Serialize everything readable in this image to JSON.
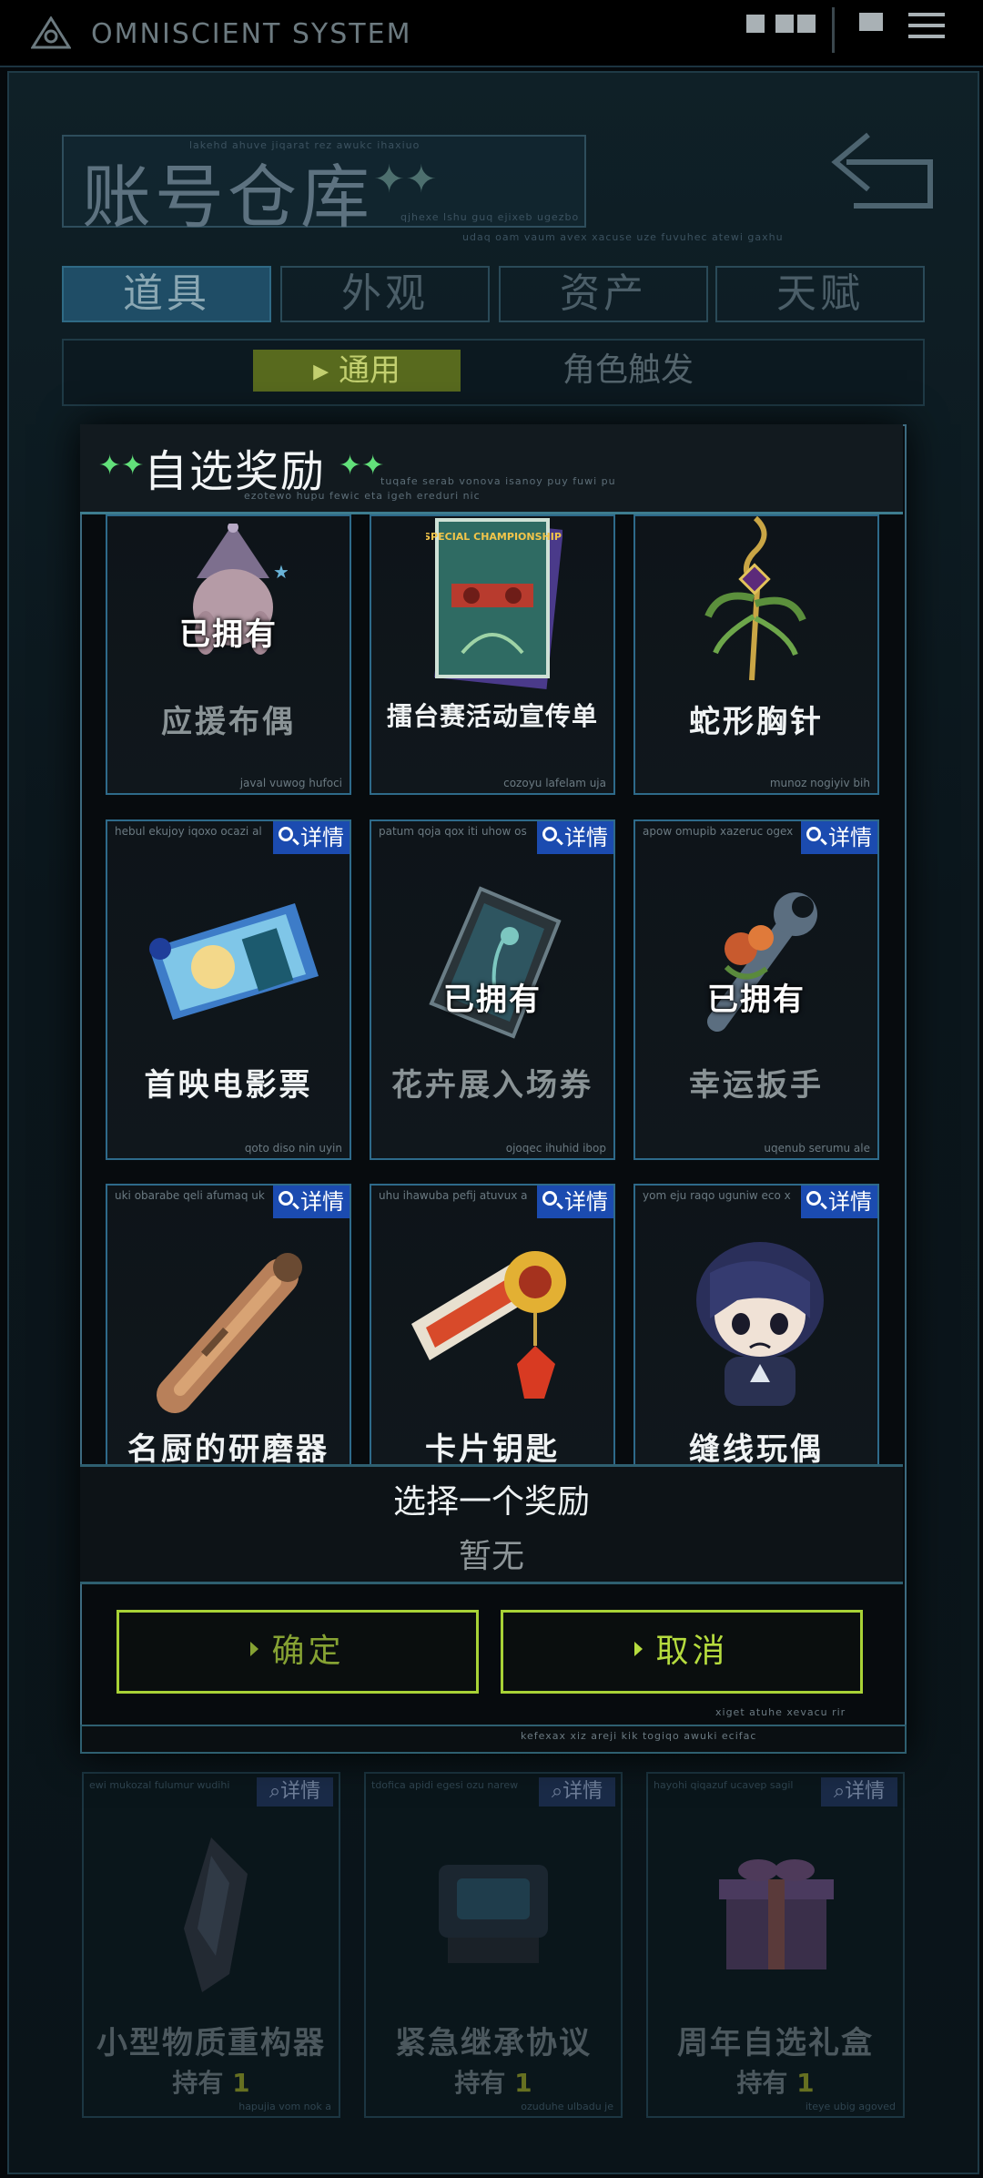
{
  "status_bar": {
    "app_name": "OMNISCIENT SYSTEM"
  },
  "warehouse": {
    "title": "账号仓库",
    "deco": "✦✦",
    "code_top": "lakehd ahuve jiqarat rez awukc ihaxiuo",
    "code_bottom": "qjhexe lshu guq ejixeb ugezbo",
    "code_line": "udaq oam vaum avex xacuse uze fuvuhec atewi gaxhu",
    "tabs": [
      "道具",
      "外观",
      "资产",
      "天赋"
    ],
    "active_tab": 0,
    "subtabs": [
      "通用",
      "角色触发"
    ],
    "active_subtab": 0
  },
  "bg_items": [
    {
      "name": "小型物质重构器",
      "count_label": "持有",
      "count": "1",
      "detail_label": "详情",
      "code": "ewi mukozal fulumur wudihi",
      "code2": "hapujia vom nok a"
    },
    {
      "name": "紧急继承协议",
      "count_label": "持有",
      "count": "1",
      "detail_label": "详情",
      "code": "tdofica apidi egesi ozu narew",
      "code2": "ozuduhe ulbadu je"
    },
    {
      "name": "周年自选礼盒",
      "count_label": "持有",
      "count": "1",
      "detail_label": "详情",
      "code": "hayohi qiqazuf ucavep sagil",
      "code2": "iteye ubig agoved"
    }
  ],
  "modal": {
    "title": "自选奖励",
    "sub1": "tuqafe serab vonova isanoy puy fuwi pu",
    "sub2": "ezotewo hupu fewic eta igeh ereduri nic",
    "owned_label": "已拥有",
    "detail_label": "详情",
    "rewards": [
      {
        "name": "应援布偶",
        "owned": true,
        "icon": "bunny-plush-icon",
        "code": "",
        "code2": "javal vuwog hufoci"
      },
      {
        "name": "擂台赛活动宣传单",
        "owned": false,
        "icon": "championship-flyer-icon",
        "code": "",
        "code2": "cozoyu lafelam uja",
        "flyer_text": "SPECIAL CHAMPIONSHIP"
      },
      {
        "name": "蛇形胸针",
        "owned": false,
        "icon": "snake-brooch-icon",
        "code": "",
        "code2": "munoz nogiyiv bih"
      },
      {
        "name": "首映电影票",
        "owned": false,
        "icon": "movie-ticket-icon",
        "code": "hebul ekujoy iqoxo ocazi al",
        "code2": "qoto diso nin uyin"
      },
      {
        "name": "花卉展入场券",
        "owned": true,
        "icon": "flower-ticket-icon",
        "code": "patum qoja qox iti uhow os",
        "code2": "ojoqec ihuhid ibop"
      },
      {
        "name": "幸运扳手",
        "owned": true,
        "icon": "lucky-wrench-icon",
        "code": "apow omupib xazeruc ogex",
        "code2": "uqenub serumu ale"
      },
      {
        "name": "名厨的研磨器",
        "owned": false,
        "icon": "pepper-grinder-icon",
        "code": "uki obarabe qeli afumaq uk",
        "code2": ""
      },
      {
        "name": "卡片钥匙",
        "owned": false,
        "icon": "card-key-icon",
        "code": "uhu ihawuba pefij atuvux a",
        "code2": ""
      },
      {
        "name": "缝线玩偶",
        "owned": false,
        "icon": "stitched-doll-icon",
        "code": "yom eju raqo uguniw eco x",
        "code2": ""
      }
    ],
    "select_label": "选择一个奖励",
    "select_value": "暂无",
    "confirm_label": "确定",
    "cancel_label": "取消",
    "foot1": "xiget atuhe xevacu rir",
    "foot2": "kefexax xiz areji kik togiqo awuki ecifac"
  }
}
